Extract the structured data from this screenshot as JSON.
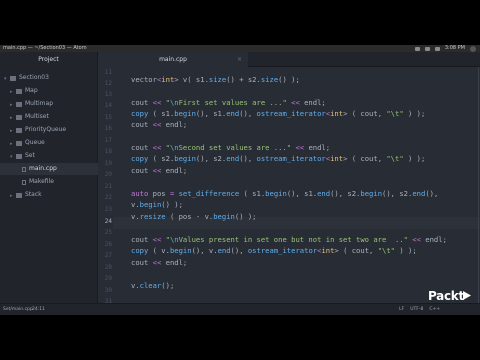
{
  "window": {
    "title": "main.cpp — ~/Section03 — Atom",
    "clock": "3:08 PM"
  },
  "tabs": {
    "project_label": "Project",
    "file_label": "main.cpp"
  },
  "sidebar": {
    "root": "Section03",
    "items": [
      {
        "label": "Map",
        "type": "folder"
      },
      {
        "label": "Multimap",
        "type": "folder"
      },
      {
        "label": "Multiset",
        "type": "folder"
      },
      {
        "label": "PriorityQueue",
        "type": "folder"
      },
      {
        "label": "Queue",
        "type": "folder"
      },
      {
        "label": "Set",
        "type": "folder-open"
      },
      {
        "label": "main.cpp",
        "type": "file"
      },
      {
        "label": "Makefile",
        "type": "file"
      },
      {
        "label": "Stack",
        "type": "folder"
      }
    ]
  },
  "editor": {
    "line_numbers": [
      "11",
      "12",
      "13",
      "14",
      "15",
      "16",
      "17",
      "18",
      "19",
      "20",
      "21",
      "22",
      "23",
      "24",
      "25",
      "26",
      "27",
      "28",
      "29",
      "30",
      "31"
    ],
    "current_line": "24"
  },
  "statusbar": {
    "file": "Set/main.cpp",
    "position": "24:11",
    "encoding": "UTF-8",
    "grammar": "C++",
    "line_ending": "LF"
  },
  "watermark": {
    "brand": "Packt",
    "tagline": "> Packt"
  },
  "colors": {
    "keyword": "#c678dd",
    "type": "#e5c07b",
    "string": "#98c379",
    "function": "#61afef",
    "punct": "#abb2bf",
    "escape": "#56b6c2",
    "number": "#d19a66"
  }
}
